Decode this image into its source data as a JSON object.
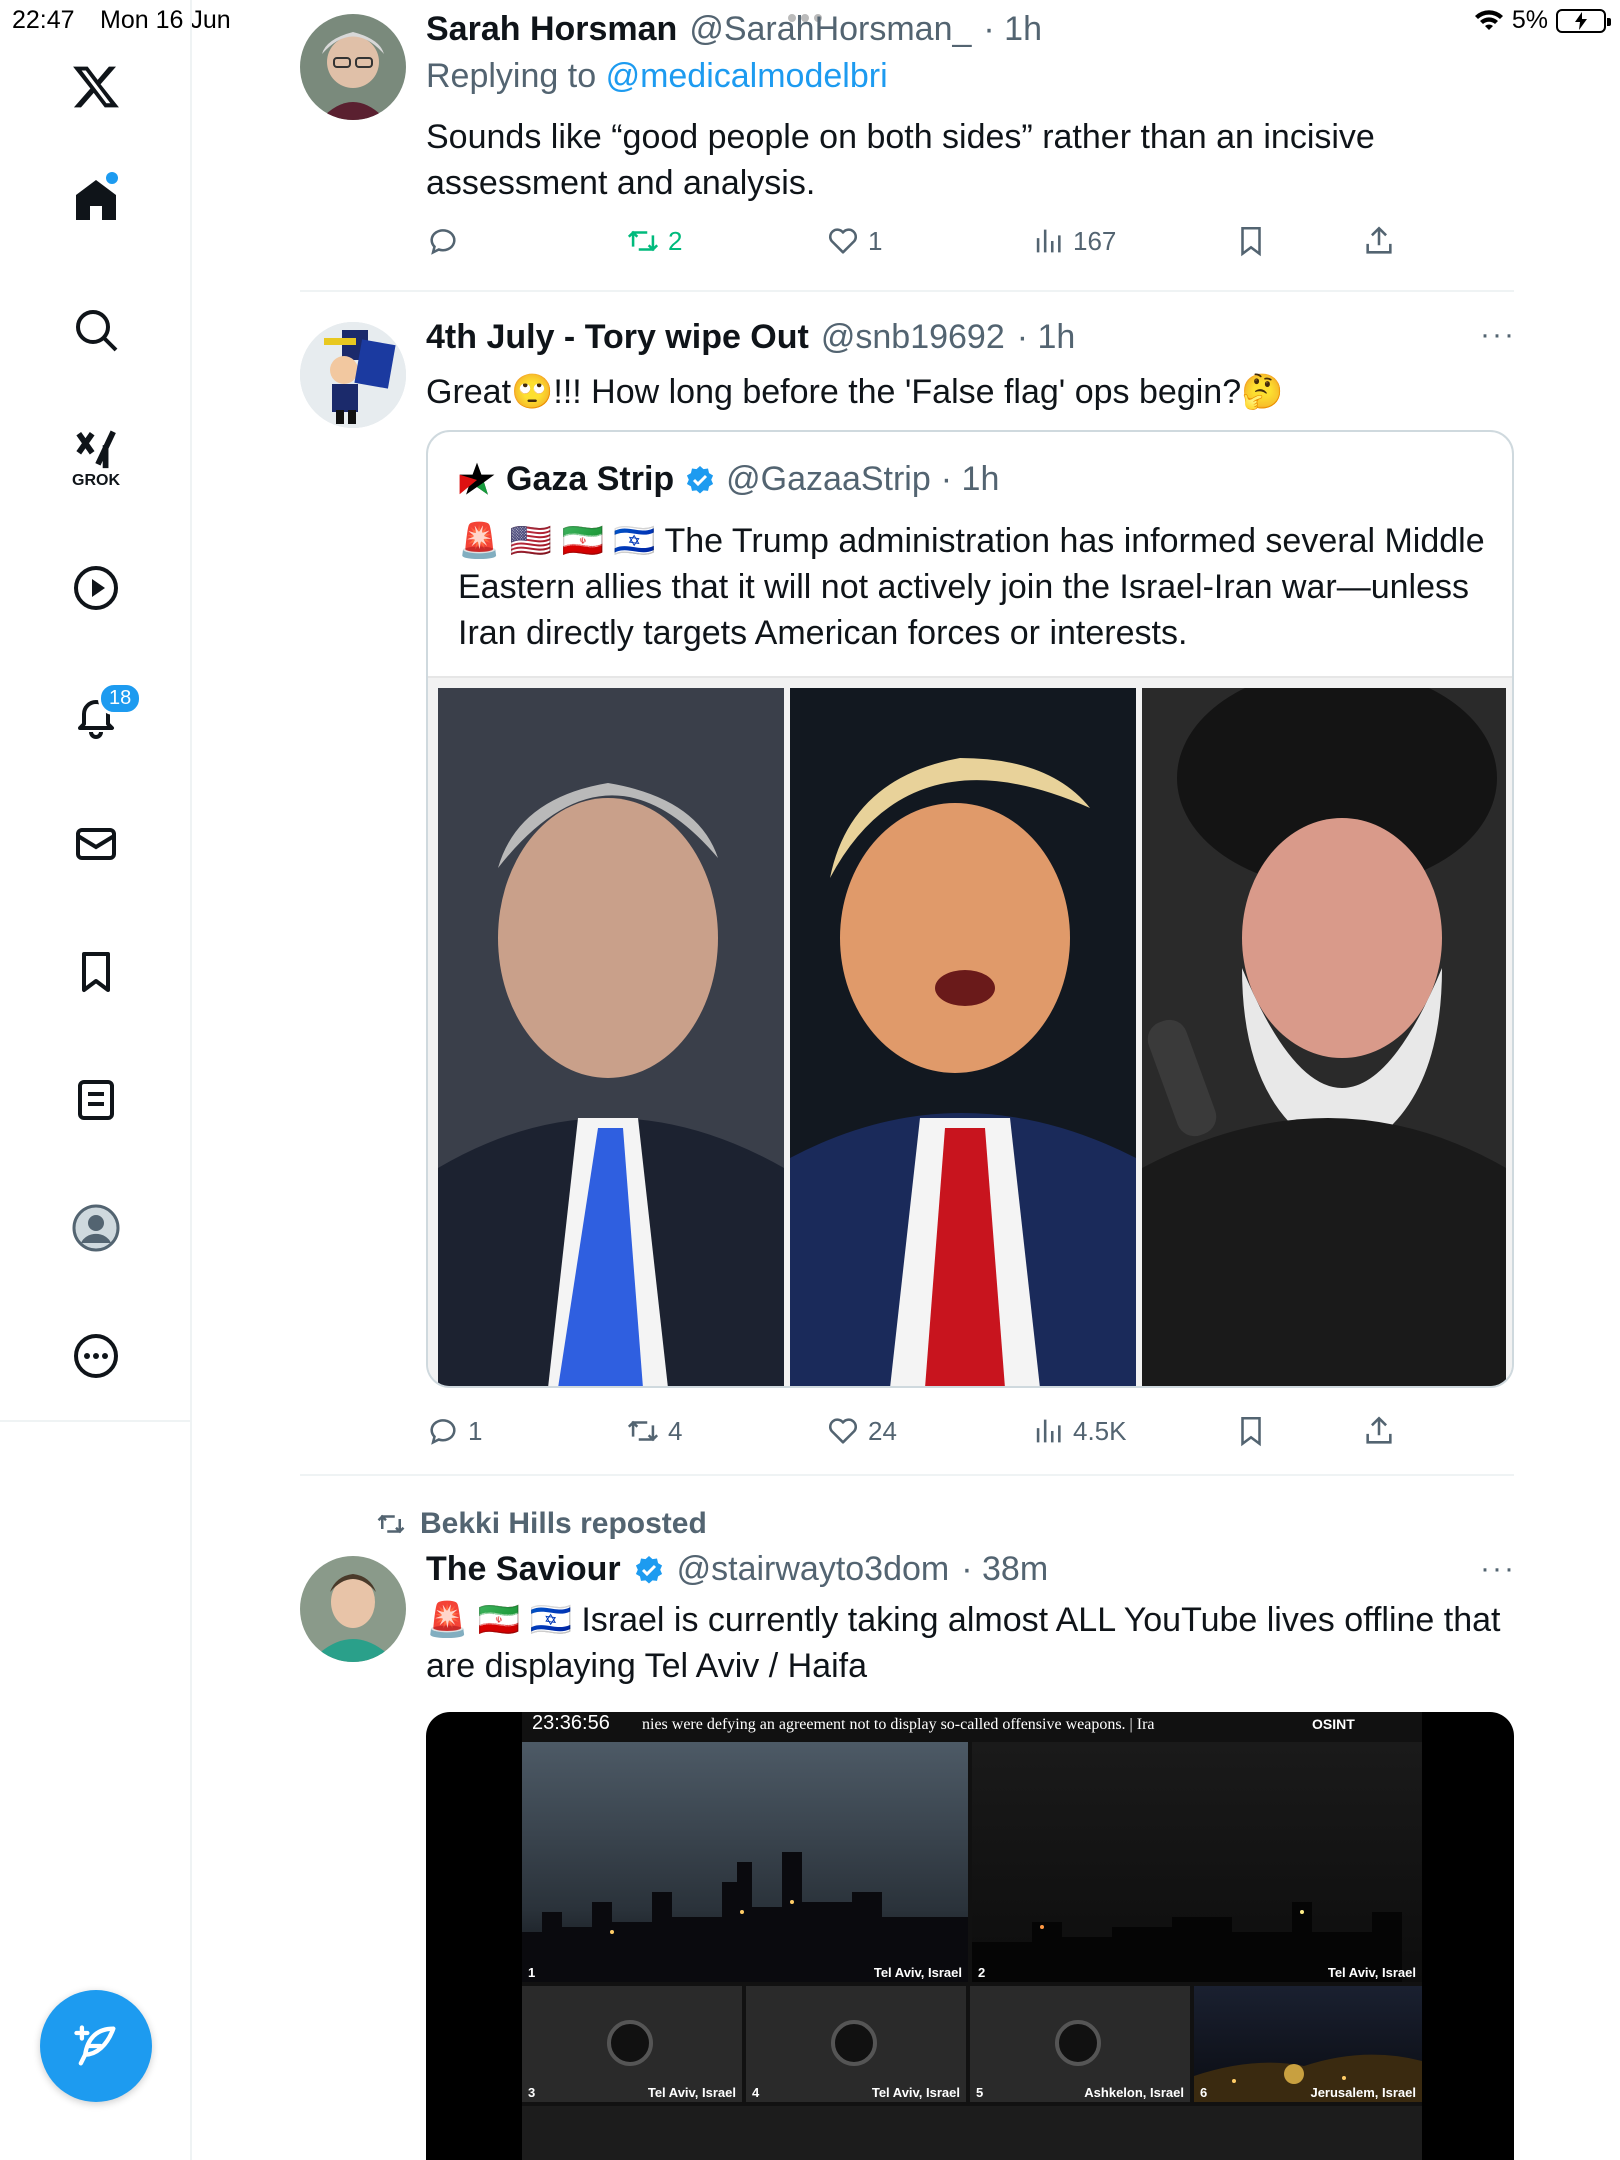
{
  "status_bar": {
    "time": "22:47",
    "date": "Mon 16 Jun",
    "battery": "5%"
  },
  "sidebar": {
    "items": [
      {
        "name": "x-logo"
      },
      {
        "name": "home"
      },
      {
        "name": "search"
      },
      {
        "name": "grok",
        "label": "GROK"
      },
      {
        "name": "videos"
      },
      {
        "name": "notifications",
        "badge": "18"
      },
      {
        "name": "messages"
      },
      {
        "name": "bookmarks"
      },
      {
        "name": "lists"
      },
      {
        "name": "profile"
      },
      {
        "name": "more"
      }
    ]
  },
  "tweets": [
    {
      "name": "Sarah Horsman",
      "handle": "@SarahHorsman_",
      "time": "· 1h",
      "replying_label": "Replying to",
      "replying_to": "@medicalmodelbri",
      "text": "Sounds like “good people on both sides” rather than an incisive assessment and analysis.",
      "stats": {
        "replies": "",
        "reposts": "2",
        "likes": "1",
        "views": "167"
      }
    },
    {
      "name": "4th July - Tory wipe Out",
      "handle": "@snb19692",
      "time": "· 1h",
      "text": "Great🙄!!! How long before the 'False flag' ops begin?🤔",
      "more": "···",
      "quote": {
        "name": "Gaza Strip",
        "handle": "@GazaaStrip",
        "time": "· 1h",
        "text": "🚨 🇺🇸 🇮🇷 🇮🇱 The Trump administration has informed several Middle Eastern allies that it will not actively join the Israel-Iran war—unless Iran directly targets American forces or interests."
      },
      "stats": {
        "replies": "1",
        "reposts": "4",
        "likes": "24",
        "views": "4.5K"
      }
    },
    {
      "repost_by": "Bekki Hills reposted",
      "name": "The Saviour",
      "handle": "@stairwayto3dom",
      "time": "· 38m",
      "text": "🚨 🇮🇷 🇮🇱 Israel is currently taking almost ALL YouTube lives offline that are displaying Tel Aviv / Haifa",
      "more": "···",
      "video": {
        "timestamp": "23:36:56",
        "ticker": "nies were defying an agreement not to display so-called offensive weapons.    |    Ira",
        "brand": "OSINT",
        "cells": [
          {
            "num": "1",
            "label": "Tel Aviv, Israel"
          },
          {
            "num": "2",
            "label": "Tel Aviv, Israel"
          },
          {
            "num": "3",
            "label": "Tel Aviv, Israel"
          },
          {
            "num": "4",
            "label": "Tel Aviv, Israel"
          },
          {
            "num": "5",
            "label": "Ashkelon, Israel"
          },
          {
            "num": "6",
            "label": "Jerusalem, Israel"
          }
        ]
      }
    }
  ],
  "colors": {
    "accent": "#1d9bf0",
    "repost_green": "#00ba7c",
    "muted": "#536471",
    "text": "#0f1419"
  }
}
